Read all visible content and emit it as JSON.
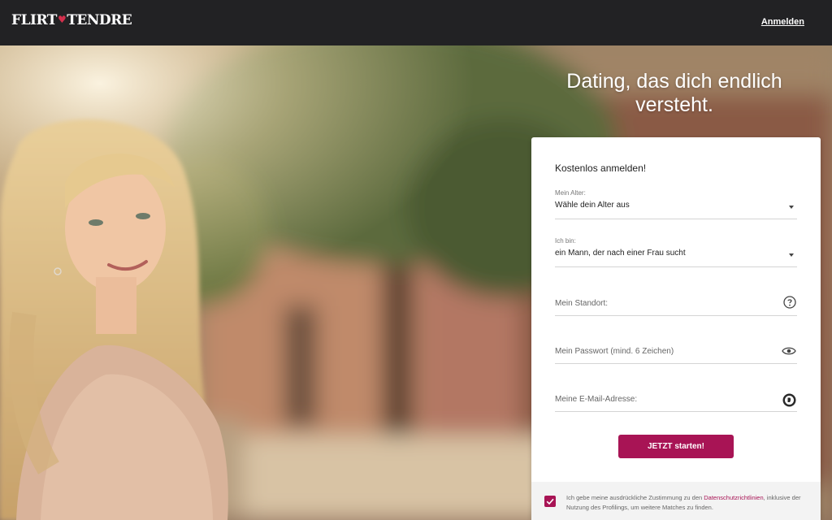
{
  "header": {
    "logo_left": "FLIRT",
    "logo_right": "TENDRE",
    "login_label": "Anmelden"
  },
  "hero": {
    "headline_line1": "Dating, das dich endlich",
    "headline_line2": "versteht."
  },
  "form": {
    "title": "Kostenlos anmelden!",
    "age": {
      "label": "Mein Alter:",
      "value": "Wähle dein Alter aus"
    },
    "iam": {
      "label": "Ich bin:",
      "value": "ein Mann, der nach einer Frau sucht"
    },
    "location": {
      "placeholder": "Mein Standort:"
    },
    "password": {
      "placeholder": "Mein Passwort (mind. 6 Zeichen)"
    },
    "email": {
      "placeholder": "Meine E-Mail-Adresse:"
    },
    "submit_label": "JETZT starten!",
    "consent_before": "Ich gebe meine ausdrückliche Zustimmung zu den ",
    "consent_link": "Datenschutzrichtlinien",
    "consent_after": ", inklusive der Nutzung des Profilings, um weitere Matches zu finden."
  },
  "colors": {
    "accent": "#a81455",
    "topbar": "#222224"
  },
  "icons": [
    "heart-icon",
    "chevron-down-icon",
    "help-icon",
    "eye-icon",
    "email-icon",
    "checkmark-icon"
  ]
}
